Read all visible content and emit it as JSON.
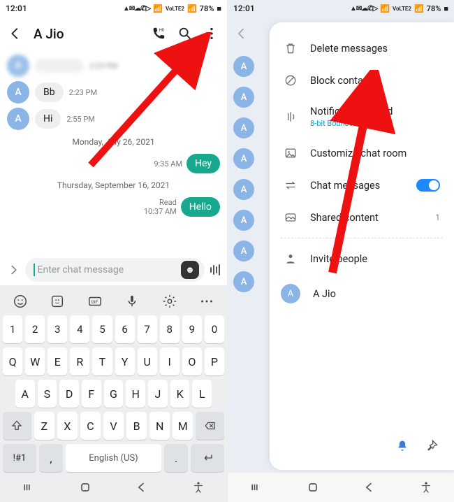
{
  "status": {
    "time": "12:01",
    "battery": "78%",
    "net_label": "VoLTE2",
    "signal_icon": "signal-icon",
    "wifi_icon": "wifi-icon"
  },
  "left": {
    "title": "A Jio",
    "avatar_letter": "A",
    "messages_in": [
      {
        "text": "",
        "time": "2:23 PM",
        "blurred": true
      },
      {
        "text": "Bb",
        "time": "2:23 PM",
        "blurred": false
      },
      {
        "text": "Hi",
        "time": "2:55 PM",
        "blurred": false
      }
    ],
    "divider1": "Monday, July 26, 2021",
    "out1": {
      "text": "Hey",
      "time": "9:35 AM"
    },
    "divider2": "Thursday, September 16, 2021",
    "out2": {
      "text": "Hello",
      "time": "10:37 AM",
      "status": "Read"
    },
    "input_placeholder": "Enter chat message",
    "keyboard": {
      "row_num": [
        "1",
        "2",
        "3",
        "4",
        "5",
        "6",
        "7",
        "8",
        "9",
        "0"
      ],
      "row1": [
        "Q",
        "W",
        "E",
        "R",
        "T",
        "Y",
        "U",
        "I",
        "O",
        "P"
      ],
      "row2": [
        "A",
        "S",
        "D",
        "F",
        "G",
        "H",
        "J",
        "K",
        "L"
      ],
      "row3": [
        "Z",
        "X",
        "C",
        "V",
        "B",
        "N",
        "M"
      ],
      "sym": "!#1",
      "comma": ",",
      "space": "English (US)",
      "period": "."
    }
  },
  "right": {
    "title": "A Jio",
    "avatar_letter": "A",
    "menu": {
      "delete": "Delete messages",
      "block": "Block contact",
      "notif": "Notification sound",
      "notif_sub": "8-bit Bounce",
      "customize": "Customize chat room",
      "chatmsgs": "Chat messages",
      "shared": "Shared content",
      "shared_count": "1",
      "invite": "Invite people",
      "contact": "A Jio"
    }
  }
}
